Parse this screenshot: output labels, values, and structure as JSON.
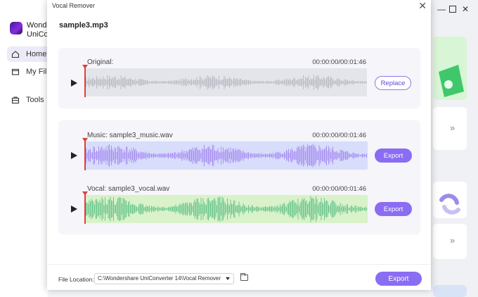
{
  "background": {
    "app_name": "Wondershare UniConverter",
    "app_name_line1": "Wonde",
    "app_name_line2": "UniConv",
    "nav": [
      {
        "label": "Home",
        "icon": "home-icon"
      },
      {
        "label": "My Files",
        "icon": "files-icon"
      },
      {
        "label": "Tools",
        "icon": "toolbox-icon"
      }
    ],
    "window_controls": [
      "minimize-icon",
      "maximize-icon",
      "close-icon"
    ]
  },
  "dialog": {
    "title": "Vocal Remover",
    "close_icon": "close-icon",
    "file_name": "sample3.mp3"
  },
  "original": {
    "label": "Original:",
    "time": "00:00:00/00:01:46",
    "button": "Replace",
    "color": "#b9bcc4"
  },
  "music": {
    "label": "Music: sample3_music.wav",
    "time": "00:00:00/00:01:46",
    "button": "Export",
    "color": "#a98ff2"
  },
  "vocal": {
    "label": "Vocal: sample3_vocal.wav",
    "time": "00:00:00/00:01:46",
    "button": "Export",
    "color": "#6cc58f"
  },
  "footer": {
    "file_location_label": "File Location:",
    "file_location_value": "C:\\Wondershare UniConverter 14\\Vocal Remover",
    "export_button": "Export"
  },
  "colors": {
    "accent": "#8a6df2",
    "playhead": "#e0403a"
  }
}
